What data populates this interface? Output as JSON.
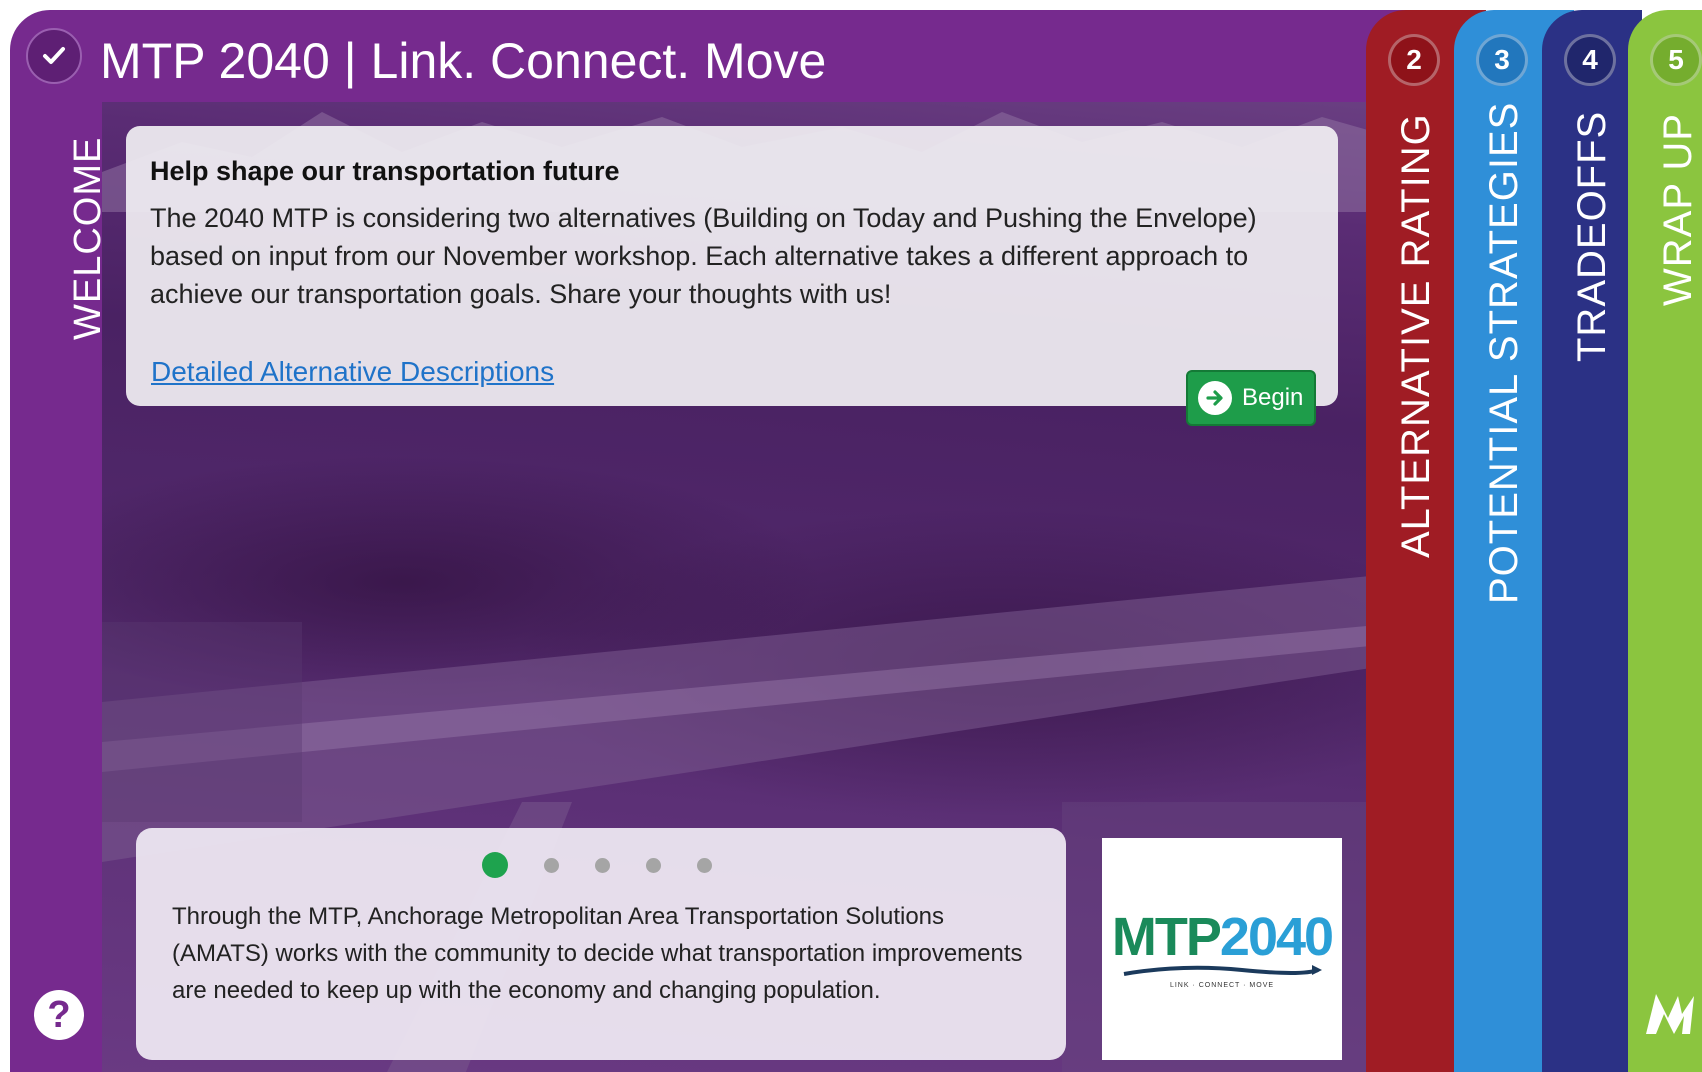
{
  "app": {
    "title": "MTP 2040 | Link. Connect. Move",
    "welcome_tab": "WELCOME"
  },
  "intro_card": {
    "heading": "Help shape our transportation future",
    "body": "The 2040 MTP is considering two alternatives (Building on Today and Pushing the Envelope) based on input from our November workshop. Each alternative takes a different approach to achieve our transportation goals. Share your thoughts with us!",
    "link_label": "Detailed Alternative Descriptions",
    "begin_label": "Begin"
  },
  "info_card": {
    "text": "Through the MTP, Anchorage Metropolitan Area Transportation Solutions (AMATS) works with the community to decide what transportation improvements are needed to keep up with the economy and changing population.",
    "carousel": {
      "count": 5,
      "active": 1
    }
  },
  "logo": {
    "text_m": "MTP",
    "text_n": "2040",
    "tagline": "LINK · CONNECT · MOVE"
  },
  "steps": [
    {
      "number": "2",
      "label": "ALTERNATIVE RATING",
      "color": "#a01c24"
    },
    {
      "number": "3",
      "label": "POTENTIAL STRATEGIES",
      "color": "#2f8fd8"
    },
    {
      "number": "4",
      "label": "TRADEOFFS",
      "color": "#2b3185"
    },
    {
      "number": "5",
      "label": "WRAP UP",
      "color": "#8bc53f"
    }
  ],
  "icons": {
    "title": "checkmark-icon",
    "help": "question-mark-icon",
    "begin": "arrow-right-circle-icon",
    "brand": "m-logo-icon"
  }
}
